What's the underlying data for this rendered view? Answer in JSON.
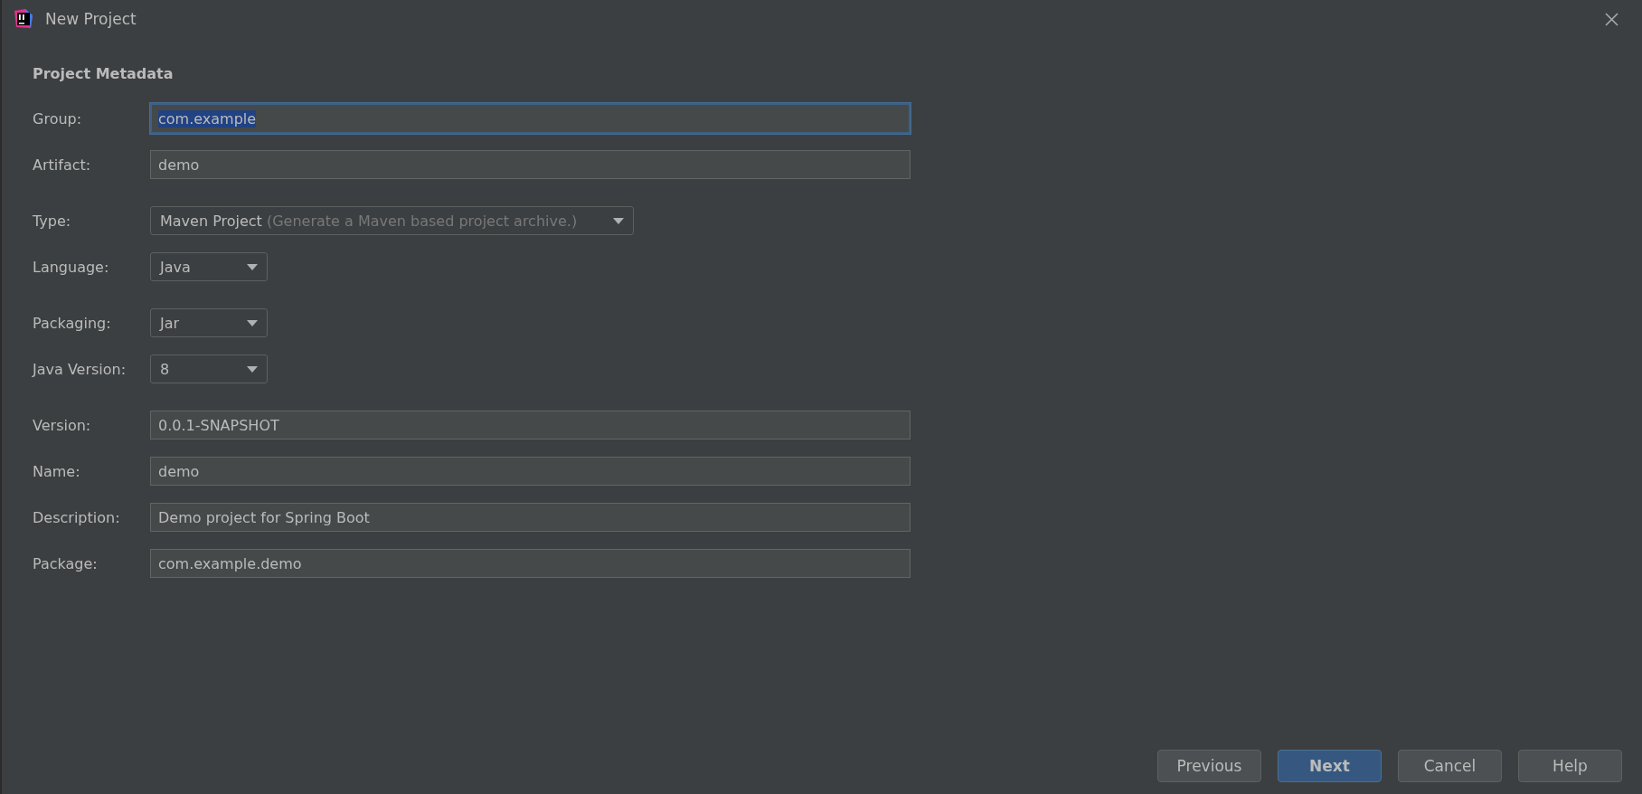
{
  "window": {
    "title": "New Project"
  },
  "heading": "Project Metadata",
  "sections": [
    {
      "fields": [
        {
          "label": "Group:",
          "kind": "text",
          "value": "com.example",
          "focused": true
        },
        {
          "label": "Artifact:",
          "kind": "text",
          "value": "demo",
          "focused": false
        }
      ]
    },
    {
      "fields": [
        {
          "label": "Type:",
          "kind": "dropdown",
          "value": "Maven Project",
          "hint": "(Generate a Maven based project archive.)",
          "focused": false
        },
        {
          "label": "Language:",
          "kind": "dropdown",
          "value": "Java",
          "focused": false
        }
      ]
    },
    {
      "fields": [
        {
          "label": "Packaging:",
          "kind": "dropdown",
          "value": "Jar",
          "focused": false
        },
        {
          "label": "Java Version:",
          "kind": "dropdown",
          "value": "8",
          "focused": false
        }
      ]
    },
    {
      "fields": [
        {
          "label": "Version:",
          "kind": "text",
          "value": "0.0.1-SNAPSHOT",
          "focused": false
        },
        {
          "label": "Name:",
          "kind": "text",
          "value": "demo",
          "focused": false
        },
        {
          "label": "Description:",
          "kind": "text",
          "value": "Demo project for Spring Boot",
          "focused": false
        },
        {
          "label": "Package:",
          "kind": "text",
          "value": "com.example.demo",
          "focused": false
        }
      ]
    }
  ],
  "buttons": [
    {
      "label": "Previous",
      "default": false
    },
    {
      "label": "Next",
      "default": true
    },
    {
      "label": "Cancel",
      "default": false
    },
    {
      "label": "Help",
      "default": false
    }
  ]
}
